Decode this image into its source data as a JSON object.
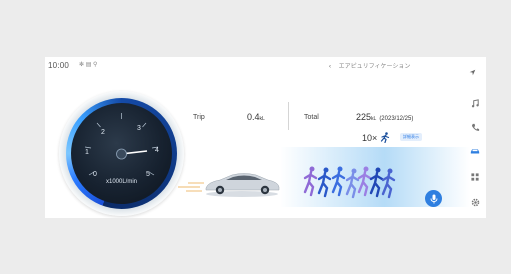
{
  "status": {
    "time": "10:00",
    "icons": "✻ ▤ ⚲"
  },
  "header": {
    "title": "エアピュリフィケーション"
  },
  "gauge": {
    "ticks": [
      "0",
      "1",
      "2",
      "3",
      "4",
      "5"
    ],
    "unit": "x1000L/min"
  },
  "trip": {
    "label": "Trip",
    "value": "0.4",
    "unit": "kL"
  },
  "total": {
    "label": "Total",
    "value": "225",
    "unit": "kL",
    "date": "(2023/12/25)"
  },
  "comparison": {
    "multiplier": "10×",
    "detail_label": "詳細表示"
  },
  "icons": {
    "nav": "navigation-arrow-icon",
    "rail": [
      "music-icon",
      "phone-icon",
      "car-icon",
      "apps-icon",
      "settings-icon"
    ],
    "mic": "microphone-icon"
  },
  "colors": {
    "accent": "#2f7fe0",
    "gauge_blue": "#2b7bff"
  }
}
